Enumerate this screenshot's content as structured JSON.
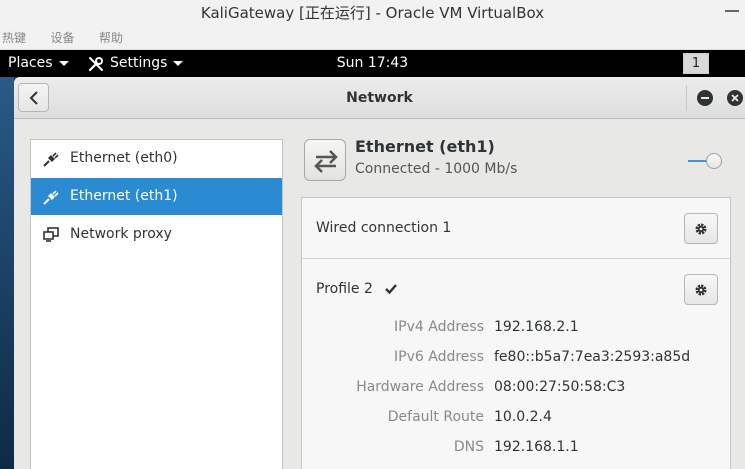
{
  "host_window": {
    "title": "KaliGateway [正在运行] - Oracle VM VirtualBox",
    "menu": [
      "热键",
      "设备",
      "帮助"
    ]
  },
  "topbar": {
    "places_label": "Places",
    "settings_label": "Settings",
    "clock": "Sun 17:43",
    "workspace": "1"
  },
  "window": {
    "title": "Network"
  },
  "sidebar": {
    "items": [
      {
        "label": "Ethernet (eth0)",
        "icon": "ethernet-plug-icon",
        "selected": false
      },
      {
        "label": "Ethernet (eth1)",
        "icon": "ethernet-plug-icon",
        "selected": true
      },
      {
        "label": "Network proxy",
        "icon": "network-proxy-icon",
        "selected": false
      }
    ]
  },
  "device": {
    "icon": "network-transfer-arrows-icon",
    "name": "Ethernet (eth1)",
    "status": "Connected - 1000 Mb/s",
    "switch_on": true
  },
  "connections": {
    "wired_label": "Wired connection 1",
    "profile_label": "Profile 2",
    "profile_active": true,
    "details": [
      {
        "label": "IPv4 Address",
        "value": "192.168.2.1"
      },
      {
        "label": "IPv6 Address",
        "value": "fe80::b5a7:7ea3:2593:a85d"
      },
      {
        "label": "Hardware Address",
        "value": "08:00:27:50:58:C3"
      },
      {
        "label": "Default Route",
        "value": "10.0.2.4"
      },
      {
        "label": "DNS",
        "value": "192.168.1.1"
      }
    ]
  },
  "colors": {
    "selection": "#2a8bd2",
    "switch_accent": "#4a90d9"
  }
}
